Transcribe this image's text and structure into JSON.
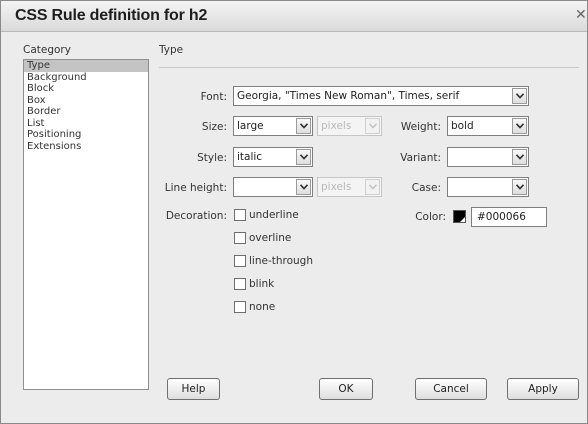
{
  "window": {
    "title": "CSS Rule definition for h2",
    "close_glyph": "✕"
  },
  "category": {
    "header": "Category",
    "items": [
      "Type",
      "Background",
      "Block",
      "Box",
      "Border",
      "List",
      "Positioning",
      "Extensions"
    ],
    "selected": "Type"
  },
  "section": {
    "title": "Type"
  },
  "fields": {
    "font": {
      "label": "Font:",
      "value": "Georgia, \"Times New Roman\", Times, serif"
    },
    "size": {
      "label": "Size:",
      "value": "large",
      "unit": "pixels"
    },
    "weight": {
      "label": "Weight:",
      "value": "bold"
    },
    "style": {
      "label": "Style:",
      "value": "italic"
    },
    "variant": {
      "label": "Variant:",
      "value": ""
    },
    "line_height": {
      "label": "Line height:",
      "value": "",
      "unit": "pixels"
    },
    "case": {
      "label": "Case:",
      "value": ""
    },
    "decoration": {
      "label": "Decoration:",
      "options": [
        "underline",
        "overline",
        "line-through",
        "blink",
        "none"
      ]
    },
    "color": {
      "label": "Color:",
      "value": "#000066",
      "swatch": "#000000"
    }
  },
  "buttons": {
    "help": "Help",
    "ok": "OK",
    "cancel": "Cancel",
    "apply": "Apply"
  }
}
